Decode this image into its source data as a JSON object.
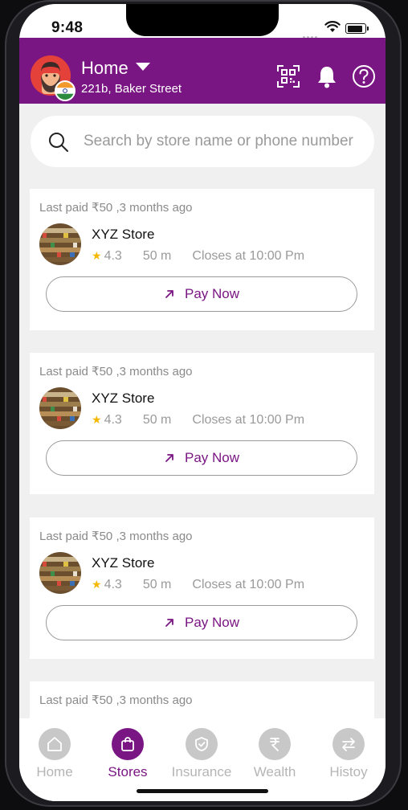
{
  "status_bar": {
    "time": "9:48"
  },
  "header": {
    "location_title": "Home",
    "address": "221b, Baker Street",
    "accent_color": "#7a1683",
    "icons": [
      "qr-scan-icon",
      "bell-icon",
      "help-icon"
    ]
  },
  "search": {
    "placeholder": "Search by store name or phone number",
    "value": ""
  },
  "stores": [
    {
      "last_paid": "Last paid ₹50 ,3 months ago",
      "name": "XYZ Store",
      "rating": "4.3",
      "distance": "50 m",
      "closes": "Closes at 10:00 Pm",
      "action": "Pay Now"
    },
    {
      "last_paid": "Last paid ₹50 ,3 months ago",
      "name": "XYZ Store",
      "rating": "4.3",
      "distance": "50 m",
      "closes": "Closes at 10:00 Pm",
      "action": "Pay Now"
    },
    {
      "last_paid": "Last paid ₹50 ,3 months ago",
      "name": "XYZ Store",
      "rating": "4.3",
      "distance": "50 m",
      "closes": "Closes at 10:00 Pm",
      "action": "Pay Now"
    },
    {
      "last_paid": "Last paid ₹50 ,3 months ago"
    }
  ],
  "tabs": [
    {
      "label": "Home",
      "icon": "home-icon",
      "active": false
    },
    {
      "label": "Stores",
      "icon": "shopping-bag-icon",
      "active": true
    },
    {
      "label": "Insurance",
      "icon": "shield-icon",
      "active": false
    },
    {
      "label": "Wealth",
      "icon": "rupee-icon",
      "active": false
    },
    {
      "label": "Histoy",
      "icon": "transfer-arrows-icon",
      "active": false
    }
  ]
}
